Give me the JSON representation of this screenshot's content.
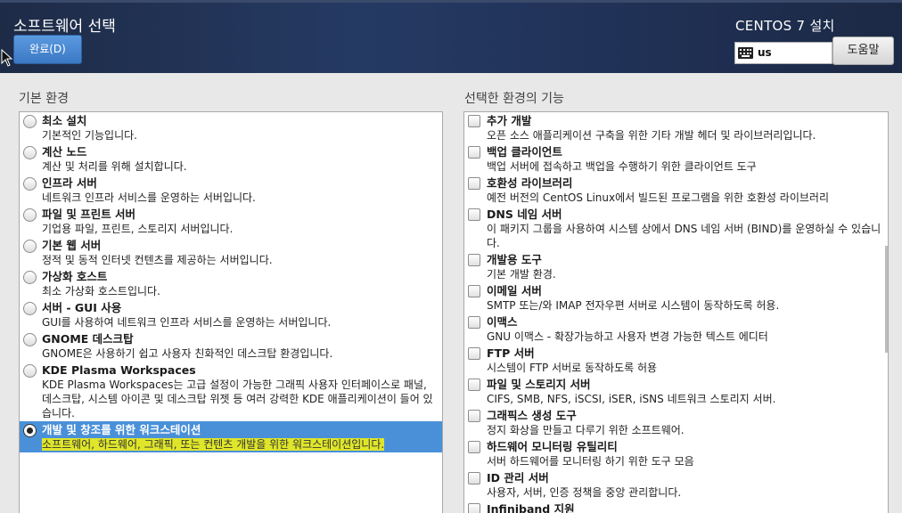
{
  "header": {
    "title": "소프트웨어 선택",
    "done_label": "완료(D)",
    "product": "CENTOS 7 설치",
    "keyboard_layout": "us",
    "help_label": "도움말"
  },
  "left": {
    "heading": "기본 환경",
    "items": [
      {
        "title": "최소 설치",
        "desc": "기본적인 기능입니다."
      },
      {
        "title": "계산 노드",
        "desc": "계산 및 처리를 위해 설치합니다."
      },
      {
        "title": "인프라 서버",
        "desc": "네트워크 인프라 서비스를 운영하는 서버입니다."
      },
      {
        "title": "파일 및 프린트 서버",
        "desc": "기업용 파일, 프린트, 스토리지 서버입니다."
      },
      {
        "title": "기본 웹 서버",
        "desc": "정적 및 동적 인터넷 컨텐츠를 제공하는 서버입니다."
      },
      {
        "title": "가상화 호스트",
        "desc": "최소 가상화 호스트입니다."
      },
      {
        "title": "서버 - GUI 사용",
        "desc": "GUI를 사용하여 네트워크 인프라 서비스를 운영하는 서버입니다."
      },
      {
        "title": "GNOME 데스크탑",
        "desc": "GNOME은 사용하기 쉽고 사용자 친화적인 데스크탑 환경입니다."
      },
      {
        "title": "KDE Plasma Workspaces",
        "desc": "KDE Plasma Workspaces는 고급 설정이 가능한 그래픽 사용자 인터페이스로 패널, 데스크탑, 시스템 아이콘 및 데스크탑 위젯 등 여러 강력한 KDE 애플리케이션이 들어 있습니다."
      },
      {
        "title": "개발 및 창조를 위한 워크스테이션",
        "desc": "소프트웨어, 하드웨어, 그래픽, 또는 컨텐츠 개발을 위한 워크스테이션입니다.",
        "selected": true
      }
    ]
  },
  "right": {
    "heading": "선택한 환경의 기능",
    "items": [
      {
        "title": "추가 개발",
        "desc": "오픈 소스 애플리케이션 구축을 위한 기타 개발 헤더 및 라이브러리입니다."
      },
      {
        "title": "백업 클라이언트",
        "desc": "백업 서버에 접속하고 백업을 수행하기 위한 클라이언트 도구"
      },
      {
        "title": "호환성 라이브러리",
        "desc": "예전 버전의 CentOS Linux에서 빌드된 프로그램을 위한 호환성 라이브러리"
      },
      {
        "title": "DNS 네임 서버",
        "desc": "이 패키지 그룹을 사용하여 시스템 상에서 DNS 네임 서버 (BIND)를 운영하실 수 있습니다."
      },
      {
        "title": "개발용 도구",
        "desc": "기본 개발 환경."
      },
      {
        "title": "이메일 서버",
        "desc": "SMTP 또는/와 IMAP 전자우편 서버로 시스템이 동작하도록 허용."
      },
      {
        "title": "이맥스",
        "desc": "GNU 이맥스 - 확장가능하고 사용자 변경 가능한 텍스트 에디터"
      },
      {
        "title": "FTP 서버",
        "desc": "시스템이 FTP 서버로 동작하도록 허용"
      },
      {
        "title": "파일 및 스토리지 서버",
        "desc": "CIFS, SMB, NFS, iSCSI, iSER, iSNS 네트워크 스토리지 서버."
      },
      {
        "title": "그래픽스 생성 도구",
        "desc": "정지 화상을 만들고 다루기 위한 소프트웨어."
      },
      {
        "title": "하드웨어 모니터링 유틸리티",
        "desc": "서버 하드웨어를 모니터링 하기 위한 도구 모음"
      },
      {
        "title": "ID 관리 서버",
        "desc": "사용자, 서버, 인증 정책을 중앙 관리합니다."
      },
      {
        "title": "Infiniband 지원",
        "desc": ""
      }
    ]
  }
}
